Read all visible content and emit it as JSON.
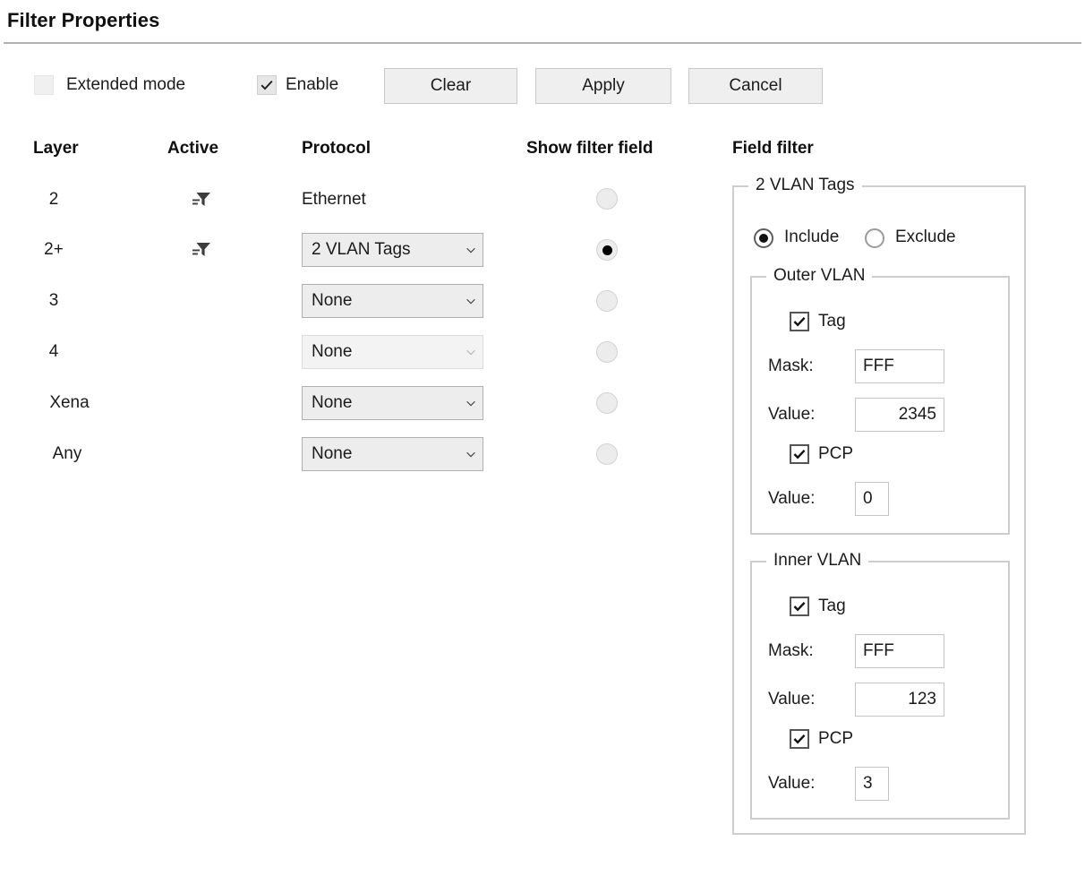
{
  "window": {
    "title": "Filter Properties"
  },
  "toolbar": {
    "extended_mode": {
      "label": "Extended mode",
      "checked": false,
      "icon": "checkbox-icon"
    },
    "enable": {
      "label": "Enable",
      "checked": true,
      "icon": "check-icon"
    },
    "clear_label": "Clear",
    "apply_label": "Apply",
    "cancel_label": "Cancel"
  },
  "grid": {
    "headers": {
      "layer": "Layer",
      "active": "Active",
      "protocol": "Protocol",
      "show_filter_field": "Show filter field",
      "field_filter": "Field filter"
    },
    "rows": [
      {
        "layer": "2",
        "active_icon": "filter-funnel-icon",
        "active": true,
        "protocol_type": "text",
        "protocol": "Ethernet",
        "selected": false,
        "disabled": false
      },
      {
        "layer": "2+",
        "active_icon": "filter-funnel-icon",
        "active": true,
        "protocol_type": "combo",
        "protocol": "2 VLAN Tags",
        "selected": true,
        "disabled": false
      },
      {
        "layer": "3",
        "active_icon": "",
        "active": false,
        "protocol_type": "combo",
        "protocol": "None",
        "selected": false,
        "disabled": false
      },
      {
        "layer": "4",
        "active_icon": "",
        "active": false,
        "protocol_type": "combo",
        "protocol": "None",
        "selected": false,
        "disabled": true
      },
      {
        "layer": "Xena",
        "active_icon": "",
        "active": false,
        "protocol_type": "combo",
        "protocol": "None",
        "selected": false,
        "disabled": false
      },
      {
        "layer": "Any",
        "active_icon": "",
        "active": false,
        "protocol_type": "combo",
        "protocol": "None",
        "selected": false,
        "disabled": false
      }
    ]
  },
  "field_filter": {
    "group_title": "2 VLAN Tags",
    "mode": {
      "include_label": "Include",
      "exclude_label": "Exclude",
      "selected": "Include"
    },
    "outer_vlan": {
      "group_title": "Outer VLAN",
      "tag": {
        "label": "Tag",
        "checked": true
      },
      "mask": {
        "label": "Mask:",
        "value": "FFF",
        "align": "left"
      },
      "value": {
        "label": "Value:",
        "value": "2345",
        "align": "right"
      },
      "pcp": {
        "label": "PCP",
        "checked": true
      },
      "pcp_value": {
        "label": "Value:",
        "value": "0",
        "align": "left"
      }
    },
    "inner_vlan": {
      "group_title": "Inner VLAN",
      "tag": {
        "label": "Tag",
        "checked": true
      },
      "mask": {
        "label": "Mask:",
        "value": "FFF",
        "align": "left"
      },
      "value": {
        "label": "Value:",
        "value": "123",
        "align": "right"
      },
      "pcp": {
        "label": "PCP",
        "checked": true
      },
      "pcp_value": {
        "label": "Value:",
        "value": "3",
        "align": "left"
      }
    }
  },
  "colors": {
    "text": "#1b1b1b",
    "rule": "#b3b3b3",
    "button_face": "#efefef",
    "button_border": "#c8c8c8",
    "combo_face": "#ededed",
    "group_border": "#cdcdcd",
    "radio_selected": "#000000"
  }
}
